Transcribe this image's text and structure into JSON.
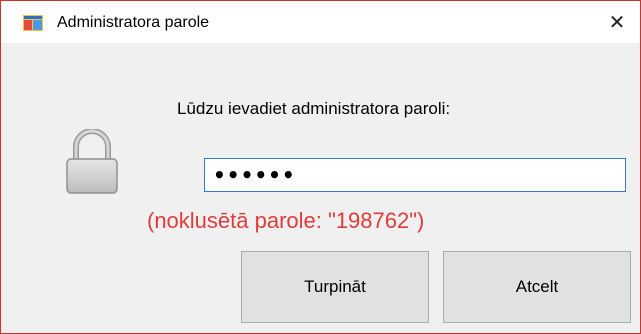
{
  "window": {
    "title": "Administratora parole",
    "close_symbol": "✕",
    "app_icon": "app-window-icon"
  },
  "dialog": {
    "prompt": "Lūdzu ievadiet administratora paroli:",
    "password_masked": "••••••",
    "hint": "(noklusētā parole: \"198762\")",
    "lock_icon": "lock-icon",
    "continue_label": "Turpināt",
    "cancel_label": "Atcelt"
  },
  "colors": {
    "hint": "#e23b3b",
    "input_border": "#2f7bd8",
    "window_border": "#c9342f",
    "dialog_bg": "#f0f0f0"
  }
}
